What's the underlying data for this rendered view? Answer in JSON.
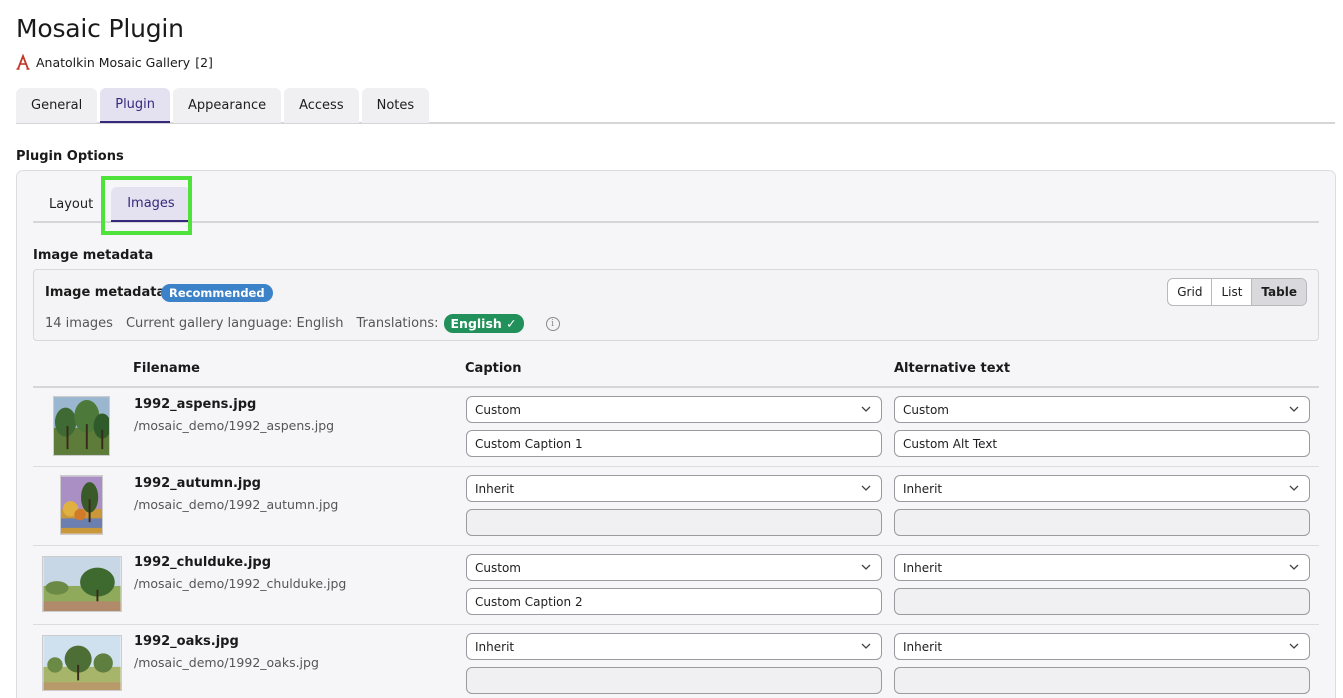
{
  "header": {
    "title": "Mosaic Plugin",
    "gallery_name": "Anatolkin Mosaic Gallery",
    "gallery_count": "[2]",
    "brand_icon": "red-a-logo-icon",
    "brand_color": "#c0392b"
  },
  "tabs": [
    {
      "label": "General"
    },
    {
      "label": "Plugin",
      "active": true
    },
    {
      "label": "Appearance"
    },
    {
      "label": "Access"
    },
    {
      "label": "Notes"
    }
  ],
  "plugin_options": {
    "title": "Plugin Options",
    "subtabs": [
      {
        "label": "Layout"
      },
      {
        "label": "Images",
        "active": true
      }
    ],
    "section_heading": "Image metadata",
    "meta_box": {
      "title": "Image metadata",
      "badge": "Recommended",
      "images_count": "14 images",
      "language_text": "Current gallery language: English",
      "translations_label": "Translations:",
      "translation_badge": "English ✓",
      "view_options": [
        "Grid",
        "List",
        "Table"
      ],
      "active_view": "Table"
    },
    "table": {
      "headers": {
        "filename": "Filename",
        "caption": "Caption",
        "alt": "Alternative text"
      },
      "rows": [
        {
          "name": "1992_aspens.jpg",
          "path": "/mosaic_demo/1992_aspens.jpg",
          "caption_mode": "Custom",
          "caption_text": "Custom Caption 1",
          "alt_mode": "Custom",
          "alt_text": "Custom Alt Text"
        },
        {
          "name": "1992_autumn.jpg",
          "path": "/mosaic_demo/1992_autumn.jpg",
          "caption_mode": "Inherit",
          "caption_text": "",
          "alt_mode": "Inherit",
          "alt_text": ""
        },
        {
          "name": "1992_chulduke.jpg",
          "path": "/mosaic_demo/1992_chulduke.jpg",
          "caption_mode": "Custom",
          "caption_text": "Custom Caption 2",
          "alt_mode": "Inherit",
          "alt_text": ""
        },
        {
          "name": "1992_oaks.jpg",
          "path": "/mosaic_demo/1992_oaks.jpg",
          "caption_mode": "Inherit",
          "caption_text": "",
          "alt_mode": "Inherit",
          "alt_text": ""
        }
      ]
    }
  },
  "colors": {
    "accent": "#35297a",
    "recommended_badge": "#3b82c8",
    "translation_badge": "#21905a",
    "highlight": "#4ee23a"
  }
}
